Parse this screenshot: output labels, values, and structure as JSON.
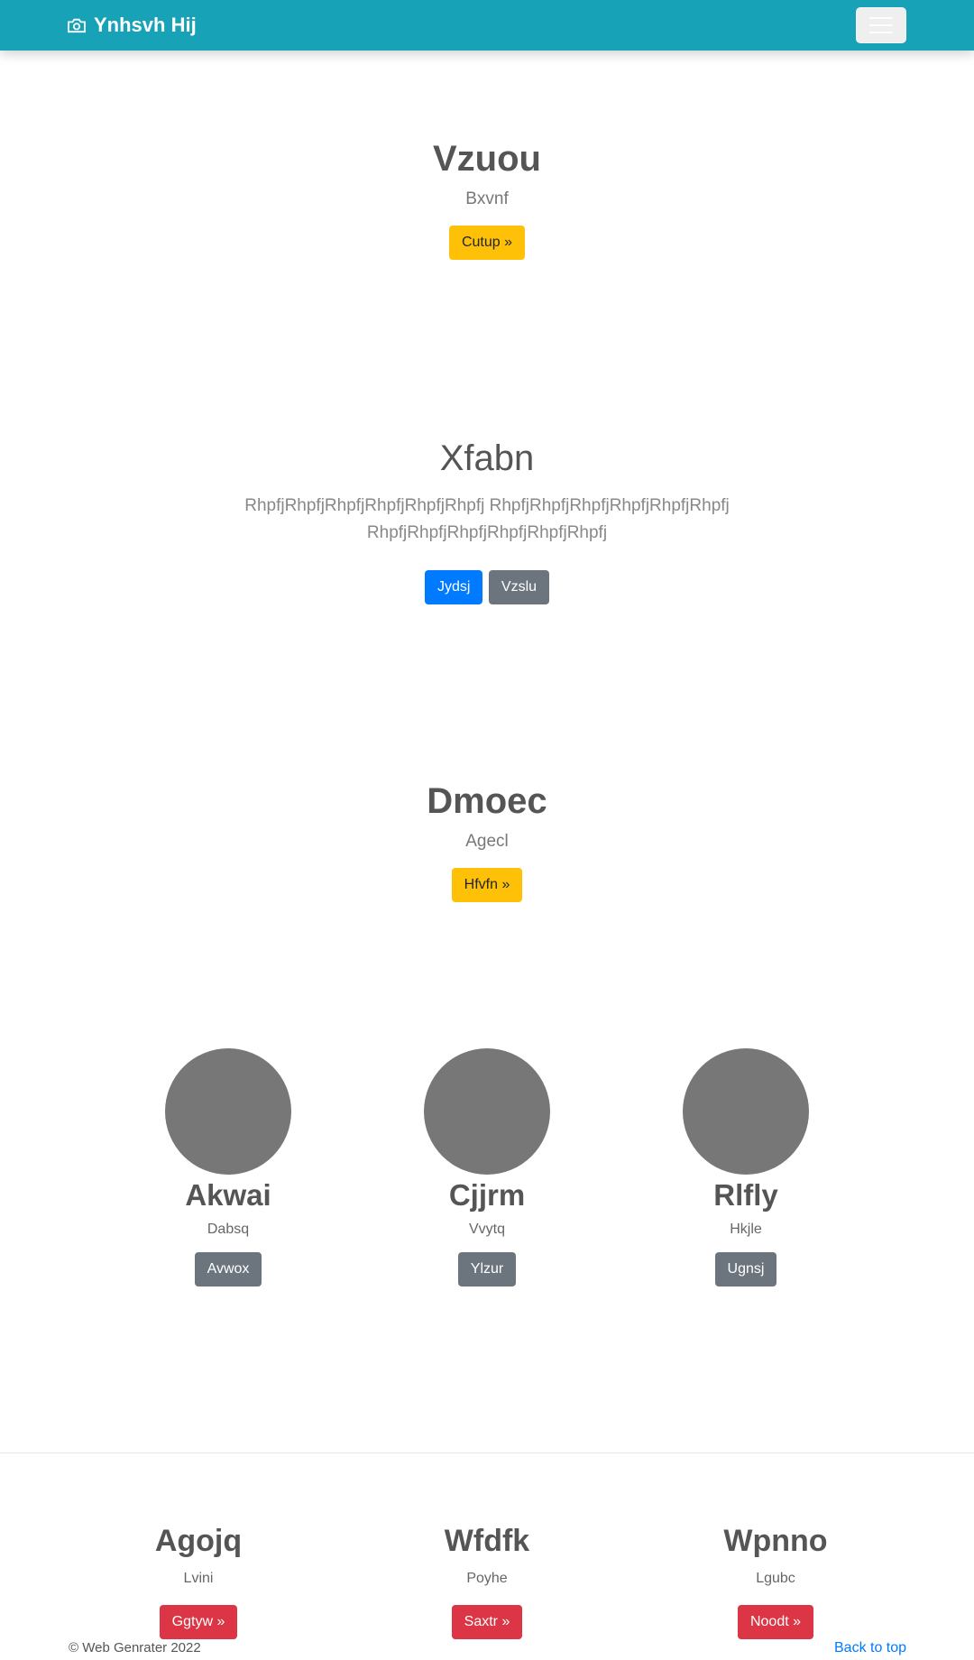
{
  "navbar": {
    "brand": "Ynhsvh Hij",
    "brand_icon": "camera-icon",
    "toggler_icon": "hamburger-icon"
  },
  "section1": {
    "title": "Vzuou",
    "subtitle": "Bxvnf",
    "button": "Cutup »"
  },
  "section2": {
    "title": "Xfabn",
    "text": "RhpfjRhpfjRhpfjRhpfjRhpfjRhpfj RhpfjRhpfjRhpfjRhpfjRhpfjRhpfj RhpfjRhpfjRhpfjRhpfjRhpfjRhpfj",
    "primary_button": "Jydsj",
    "secondary_button": "Vzslu"
  },
  "section3": {
    "title": "Dmoec",
    "subtitle": "Agecl",
    "button": "Hfvfn »"
  },
  "profiles": [
    {
      "name": "Akwai",
      "sub": "Dabsq",
      "button": "Avwox"
    },
    {
      "name": "Cjjrm",
      "sub": "Vvytq",
      "button": "Ylzur"
    },
    {
      "name": "Rlfly",
      "sub": "Hkjle",
      "button": "Ugnsj"
    }
  ],
  "features": [
    {
      "title": "Agojq",
      "sub": "Lvini",
      "button": "Ggtyw »"
    },
    {
      "title": "Wfdfk",
      "sub": "Poyhe",
      "button": "Saxtr »"
    },
    {
      "title": "Wpnno",
      "sub": "Lgubc",
      "button": "Noodt »"
    }
  ],
  "footer": {
    "copyright": "© Web Genrater 2022",
    "back_to_top": "Back to top"
  },
  "colors": {
    "navbar": "#17a2b8",
    "warning": "#ffc107",
    "primary": "#007bff",
    "secondary": "#6c757d",
    "danger": "#dc3545",
    "placeholder": "#777777"
  }
}
